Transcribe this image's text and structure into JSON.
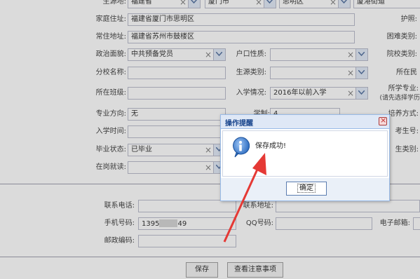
{
  "form": {
    "row0": {
      "origin_label": "生源地:",
      "province": "福建省",
      "city": "厦门市",
      "district": "思明区",
      "street": "厦港街道",
      "passport_label": "护照:"
    },
    "home_address": {
      "label": "家庭住址:",
      "value": "福建省厦门市思明区"
    },
    "permanent_address": {
      "label": "常住地址:",
      "value": "福建省苏州市鼓楼区"
    },
    "difficulty_label": "困难类别:",
    "political": {
      "label": "政治面貌:",
      "value": "中共预备党员"
    },
    "hukou": {
      "label": "户口性质:",
      "value": ""
    },
    "college_label": "院校类别:",
    "branch_school": {
      "label": "分校名称:",
      "value": ""
    },
    "source_type": {
      "label": "生源类别:",
      "value": ""
    },
    "location_label": "所在民",
    "class": {
      "label": "所在班级:",
      "value": ""
    },
    "enrollment": {
      "label": "入学情况:",
      "value": "2016年以前入学"
    },
    "major_note": {
      "line1": "所学专业:",
      "line2": "(请先选择学历"
    },
    "specialty": {
      "label": "专业方向:",
      "value": "无"
    },
    "length_label": "学制:",
    "length_value": "4",
    "training_label": "培养方式:",
    "enroll_time": {
      "label": "入学时间:",
      "value": ""
    },
    "exam_no_label": "考生号:",
    "graduation": {
      "label": "毕业状态:",
      "value": "已毕业"
    },
    "student_type_label": "生类别:",
    "employed": {
      "label": "在岗就读:",
      "value": ""
    }
  },
  "contact": {
    "phone_label": "联系电话:",
    "address_label": "联系地址:",
    "mobile_label": "手机号码:",
    "mobile_prefix": "1395",
    "mobile_suffix": "49",
    "qq_label": "QQ号码:",
    "email_label": "电子邮箱:",
    "postcode_label": "邮政编码:"
  },
  "buttons": {
    "save": "保存",
    "notes": "查看注意事项"
  },
  "dialog": {
    "title": "操作提醒",
    "message": "保存成功!",
    "ok": "确定",
    "icon": "info-icon"
  },
  "annotation": {
    "color": "#e53935",
    "shape": "red-arrow"
  },
  "colors": {
    "accent": "#15428b",
    "header_bg": "#dfe8f6",
    "border": "#99bbe8"
  }
}
